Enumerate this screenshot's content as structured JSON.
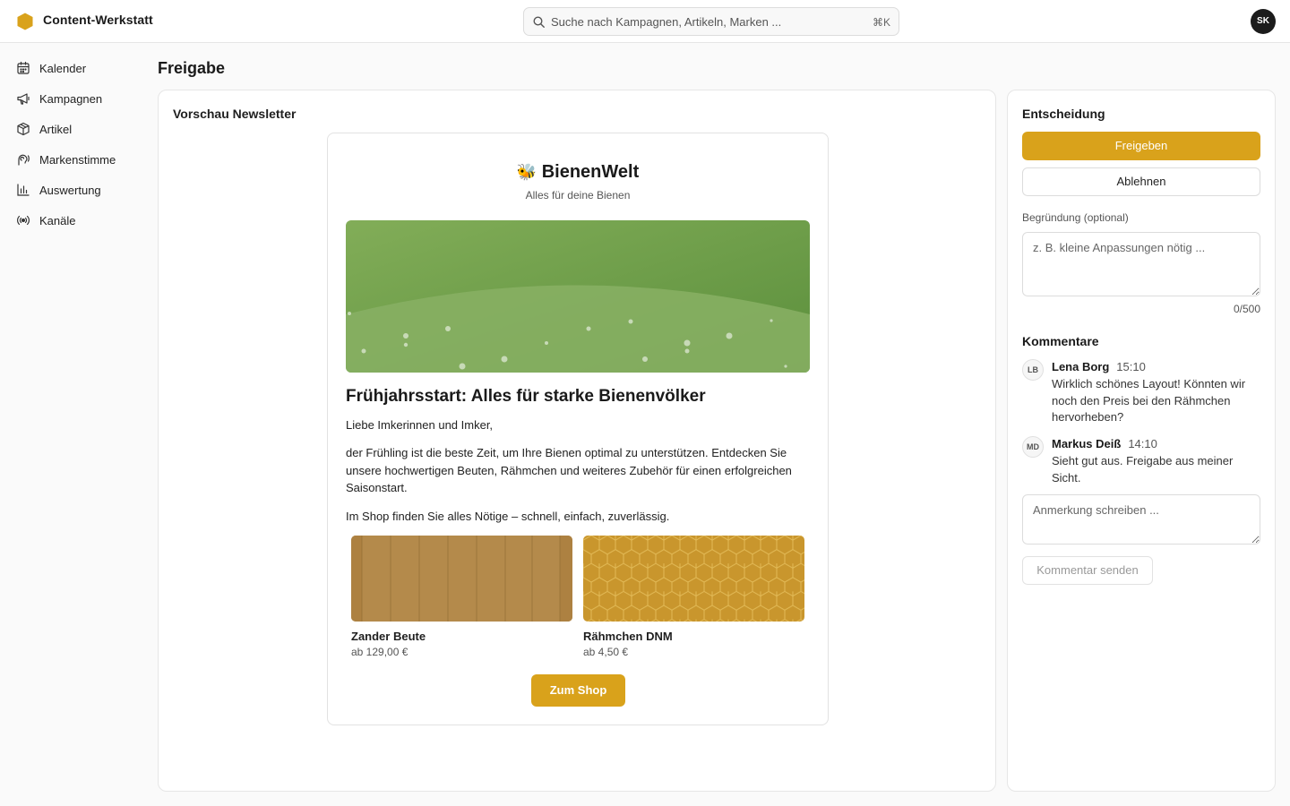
{
  "app": {
    "title": "Content-Werkstatt",
    "user_initials": "SK"
  },
  "search": {
    "placeholder": "Suche nach Kampagnen, Artikeln, Marken ...",
    "shortcut": "⌘K"
  },
  "sidebar": {
    "items": [
      {
        "label": "Kalender",
        "icon": "calendar-icon"
      },
      {
        "label": "Kampagnen",
        "icon": "megaphone-icon"
      },
      {
        "label": "Artikel",
        "icon": "box-icon"
      },
      {
        "label": "Markenstimme",
        "icon": "voice-icon"
      },
      {
        "label": "Auswertung",
        "icon": "bar-chart-icon"
      },
      {
        "label": "Kanäle",
        "icon": "broadcast-icon"
      }
    ]
  },
  "page": {
    "title": "Freigabe"
  },
  "preview": {
    "title": "Vorschau Newsletter",
    "brand_emoji": "🐝",
    "brand": "BienenWelt",
    "tagline": "Alles für deine Bienen",
    "headline": "Frühjahrsstart: Alles für starke Bienenvölker",
    "greeting": "Liebe Imkerinnen und Imker,",
    "body": "der Frühling ist die beste Zeit, um Ihre Bienen optimal zu unterstützen. Entdecken Sie unsere hochwertigen Beuten, Rähmchen und weiteres Zubehör für einen erfolgreichen Saisonstart.",
    "shop_line": "Im Shop finden Sie alles Nötige – schnell, einfach, zuverlässig.",
    "products": [
      {
        "name": "Zander Beute",
        "price": "ab 129,00 €"
      },
      {
        "name": "Rähmchen DNM",
        "price": "ab 4,50 €"
      }
    ],
    "cta": "Zum Shop"
  },
  "decision": {
    "title": "Entscheidung",
    "approve": "Freigeben",
    "reject": "Ablehnen",
    "reason_label": "Begründung (optional)",
    "reason_placeholder": "z. B. kleine Anpassungen nötig ...",
    "counter": "0/500",
    "comments_title": "Kommentare",
    "comments": [
      {
        "initials": "LB",
        "author": "Lena Borg",
        "time": "15:10",
        "text": "Wirklich schönes Layout! Könnten wir noch den Preis bei den Rähmchen hervorheben?"
      },
      {
        "initials": "MD",
        "author": "Markus Deiß",
        "time": "14:10",
        "text": "Sieht gut aus. Freigabe aus meiner Sicht."
      }
    ],
    "comment_placeholder": "Anmerkung schreiben ...",
    "send": "Kommentar senden"
  },
  "colors": {
    "accent": "#d9a21b",
    "hero_green": "#6f9e4c"
  }
}
